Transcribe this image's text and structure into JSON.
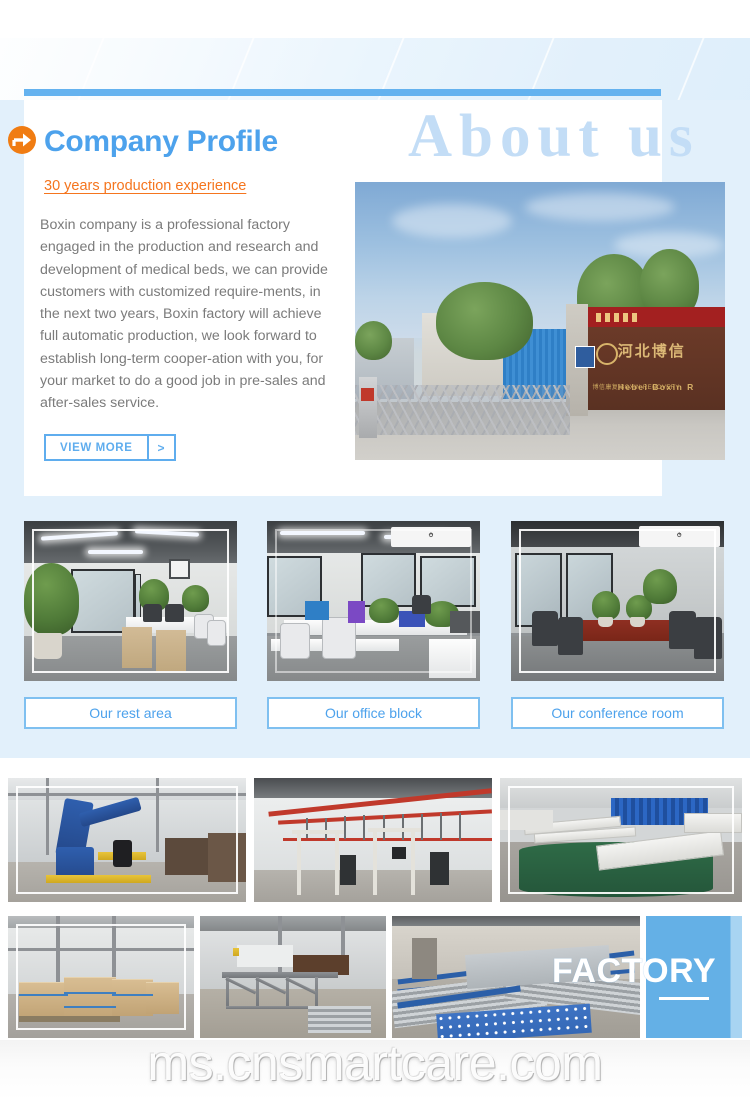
{
  "header": {
    "accent_color": "#64b2ef",
    "decor_name": "diagonal-stripe-banner"
  },
  "about": {
    "watermark_heading": "About us",
    "section_title": "Company Profile",
    "title_color": "#4da2ec",
    "arrow_icon": "circle-arrow-right-icon",
    "arrow_color": "#f07c12",
    "tagline": "30 years production experience",
    "tagline_color": "#f5751e",
    "body": "Boxin company is a professional factory engaged in the production and research and development of medical beds, we can provide customers with customized require-ments, in the next two years, Boxin factory will achieve full automatic production, we look forward to establish long-term cooper-ation with you, for your market to do a good job in pre-sales and after-sales service.",
    "button": {
      "label": "VIEW MORE",
      "arrow": ">",
      "color": "#5fadee"
    },
    "photo": {
      "name": "factory-gate-photo",
      "sign_cn": "河北博信",
      "sign_en": "Hebei  Boxin  R",
      "sign_sub": "博信康复 BOXIN RECOVERY",
      "banner_cn": "不忘初心  牢记使"
    }
  },
  "offices": [
    {
      "caption": "Our rest area",
      "photo_name": "rest-area-photo"
    },
    {
      "caption": "Our office block",
      "photo_name": "office-block-photo"
    },
    {
      "caption": "Our conference room",
      "photo_name": "conference-room-photo"
    }
  ],
  "factory": {
    "label": "FACTORY",
    "panel_color": "#64b0e6",
    "photos": [
      {
        "name": "welding-robot-photo"
      },
      {
        "name": "painting-line-photo"
      },
      {
        "name": "dipping-tank-photo"
      },
      {
        "name": "packed-cartons-photo"
      },
      {
        "name": "steel-frames-photo"
      },
      {
        "name": "roller-conveyor-photo"
      }
    ]
  },
  "footer": {
    "watermark": "ms.cnsmartcare.com"
  }
}
